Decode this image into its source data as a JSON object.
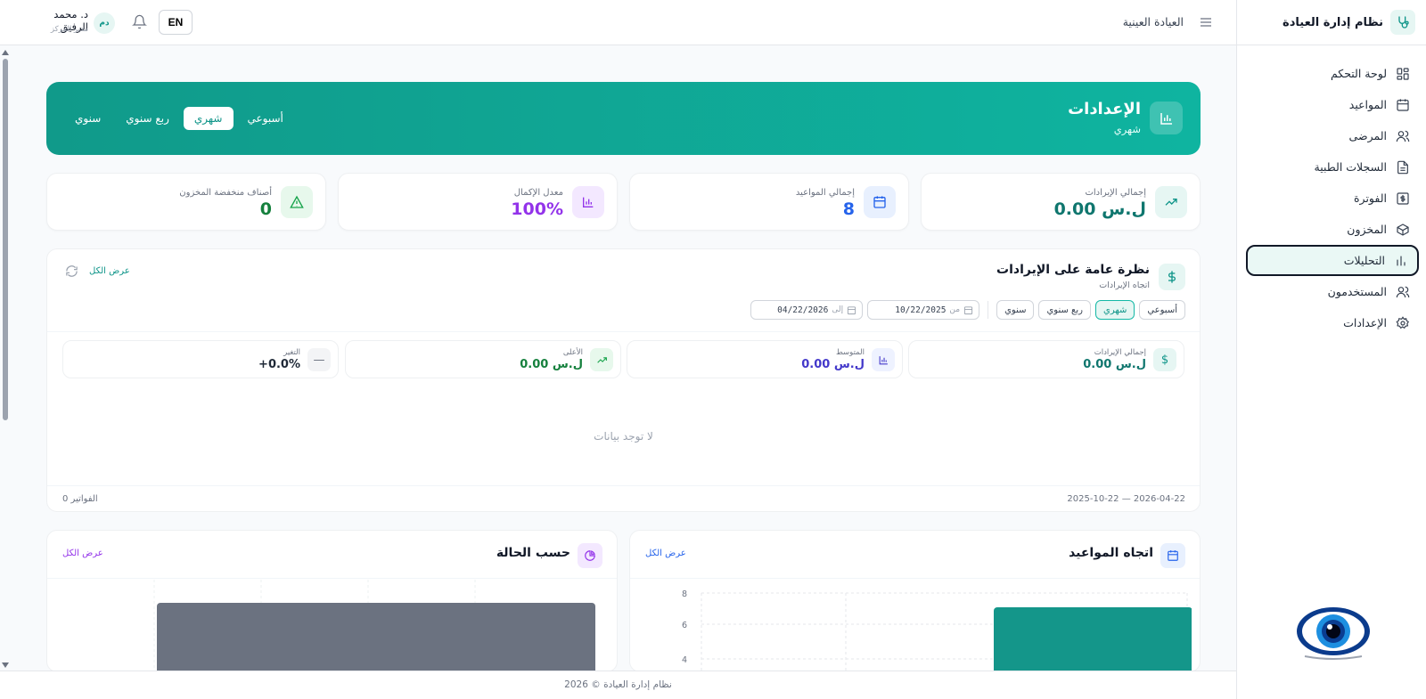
{
  "app": {
    "title": "نظام إدارة العيادة"
  },
  "sidebar": {
    "items": [
      {
        "label": "لوحة التحكم",
        "icon": "grid-icon"
      },
      {
        "label": "المواعيد",
        "icon": "calendar-icon"
      },
      {
        "label": "المرضى",
        "icon": "users-icon"
      },
      {
        "label": "السجلات الطبية",
        "icon": "file-icon"
      },
      {
        "label": "الفوترة",
        "icon": "dollar-icon"
      },
      {
        "label": "المخزون",
        "icon": "box-icon"
      },
      {
        "label": "التحليلات",
        "icon": "bar-chart-icon",
        "active": true
      },
      {
        "label": "المستخدمون",
        "icon": "users-icon"
      },
      {
        "label": "الإعدادات",
        "icon": "gear-icon"
      }
    ]
  },
  "topbar": {
    "clinic": "العيادة العينية",
    "lang": "EN",
    "user_initials": "دم",
    "user_name": "د. محمد الرفيق",
    "user_role": "مدير المركز"
  },
  "hero": {
    "title": "الإعدادات",
    "subtitle": "شهري",
    "periods": [
      "أسبوعي",
      "شهري",
      "ربع سنوي",
      "سنوي"
    ],
    "active_period": "شهري"
  },
  "stats": [
    {
      "label": "إجمالي الإيرادات",
      "value": "ل.س 0.00",
      "color": "#0f766e",
      "icon_bg": "#e6f6f3",
      "icon": "trend-up-icon"
    },
    {
      "label": "إجمالي المواعيد",
      "value": "8",
      "color": "#2563eb",
      "icon_bg": "#e8f0fe",
      "icon": "calendar-icon"
    },
    {
      "label": "معدل الإكمال",
      "value": "100%",
      "color": "#9333ea",
      "icon_bg": "#f3e8ff",
      "icon": "bar-chart-icon"
    },
    {
      "label": "أصناف منخفضة المخزون",
      "value": "0",
      "color": "#15803d",
      "icon_bg": "#e7f8ec",
      "icon": "alert-triangle-icon"
    }
  ],
  "revenue": {
    "title": "نظرة عامة على الإيرادات",
    "subtitle": "اتجاه الإيرادات",
    "view_all": "عرض الكل",
    "periods": [
      "أسبوعي",
      "شهري",
      "ربع سنوي",
      "سنوي"
    ],
    "active_period": "شهري",
    "from_label": "من",
    "from_date": "10/22/2025",
    "to_label": "إلى",
    "to_date": "04/22/2026",
    "metrics": [
      {
        "label": "إجمالي الإيرادات",
        "value": "ل.س 0.00",
        "color": "#0f766e",
        "icon_bg": "#e6f6f3",
        "icon": "dollar-icon"
      },
      {
        "label": "المتوسط",
        "value": "ل.س 0.00",
        "color": "#4338ca",
        "icon_bg": "#eef2ff",
        "icon": "bar-chart-icon"
      },
      {
        "label": "الأعلى",
        "value": "ل.س 0.00",
        "color": "#15803d",
        "icon_bg": "#e7f8ec",
        "icon": "trend-up-icon"
      },
      {
        "label": "التغير",
        "value": "+0.0%",
        "color": "#1f2937",
        "icon_bg": "#f3f4f6",
        "icon": "minus-icon"
      }
    ],
    "no_data": "لا توجد بيانات",
    "range": "2025-10-22 — 2026-04-22",
    "invoice_count": "0 الفواتير"
  },
  "appointments_panel": {
    "title": "اتجاه المواعيد",
    "view_all": "عرض الكل",
    "y_ticks": [
      "8",
      "6",
      "4"
    ]
  },
  "status_panel": {
    "title": "حسب الحالة",
    "view_all": "عرض الكل"
  },
  "footer": {
    "text": "نظام إدارة العيادة © 2026"
  },
  "colors": {
    "accent": "#0d9488",
    "hero_start": "#109a8a",
    "hero_end": "#0fb4a0"
  }
}
